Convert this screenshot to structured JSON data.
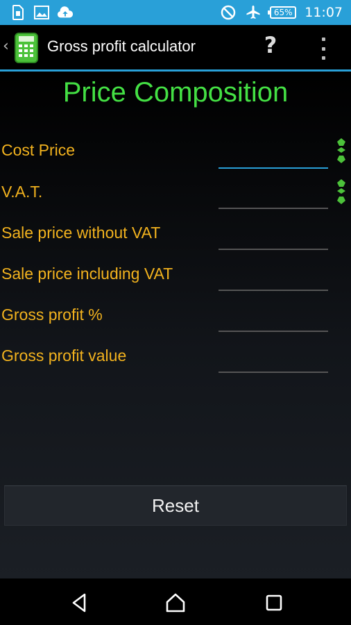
{
  "status_bar": {
    "battery_percent": "65%",
    "time": "11:07",
    "left_icons": [
      "sim-icon",
      "image-icon",
      "cloud-upload-icon"
    ],
    "right_icons": [
      "do-not-disturb-icon",
      "airplane-icon",
      "battery-icon"
    ]
  },
  "app_bar": {
    "title": "Gross profit calculator",
    "help_label": "?"
  },
  "page": {
    "title": "Price Composition"
  },
  "fields": [
    {
      "label": "Cost Price",
      "value": ""
    },
    {
      "label": "V.A.T.",
      "value": ""
    },
    {
      "label": "Sale price without VAT",
      "value": ""
    },
    {
      "label": "Sale price including VAT",
      "value": ""
    },
    {
      "label": "Gross profit %",
      "value": ""
    },
    {
      "label": "Gross profit value",
      "value": ""
    }
  ],
  "reset_label": "Reset",
  "colors": {
    "accent": "#29a0d8",
    "title_green": "#44e044",
    "label_orange": "#f2b21e"
  }
}
